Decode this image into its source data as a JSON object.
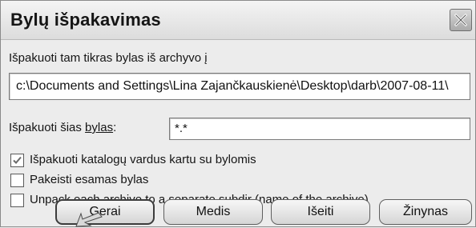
{
  "window": {
    "title": "Bylų išpakavimas",
    "close_icon": "close-icon"
  },
  "extract_to": {
    "label": "Išpakuoti tam tikras bylas iš archyvo į",
    "path_value": "c:\\Documents and Settings\\Lina Zajančkauskienė\\Desktop\\darb\\2007-08-11\\"
  },
  "files": {
    "label": "Išpakuoti šias bylas:",
    "value": "*.*"
  },
  "options": [
    {
      "label": "Išpakuoti katalogų vardus kartu su bylomis",
      "checked": true
    },
    {
      "label": "Pakeisti esamas bylas",
      "checked": false
    },
    {
      "label": "Unpack each archive to a separate subdir (name of the archive)",
      "checked": false
    }
  ],
  "buttons": {
    "ok": "Gerai",
    "tree": "Medis",
    "exit": "Išeiti",
    "help": "Žinynas"
  }
}
